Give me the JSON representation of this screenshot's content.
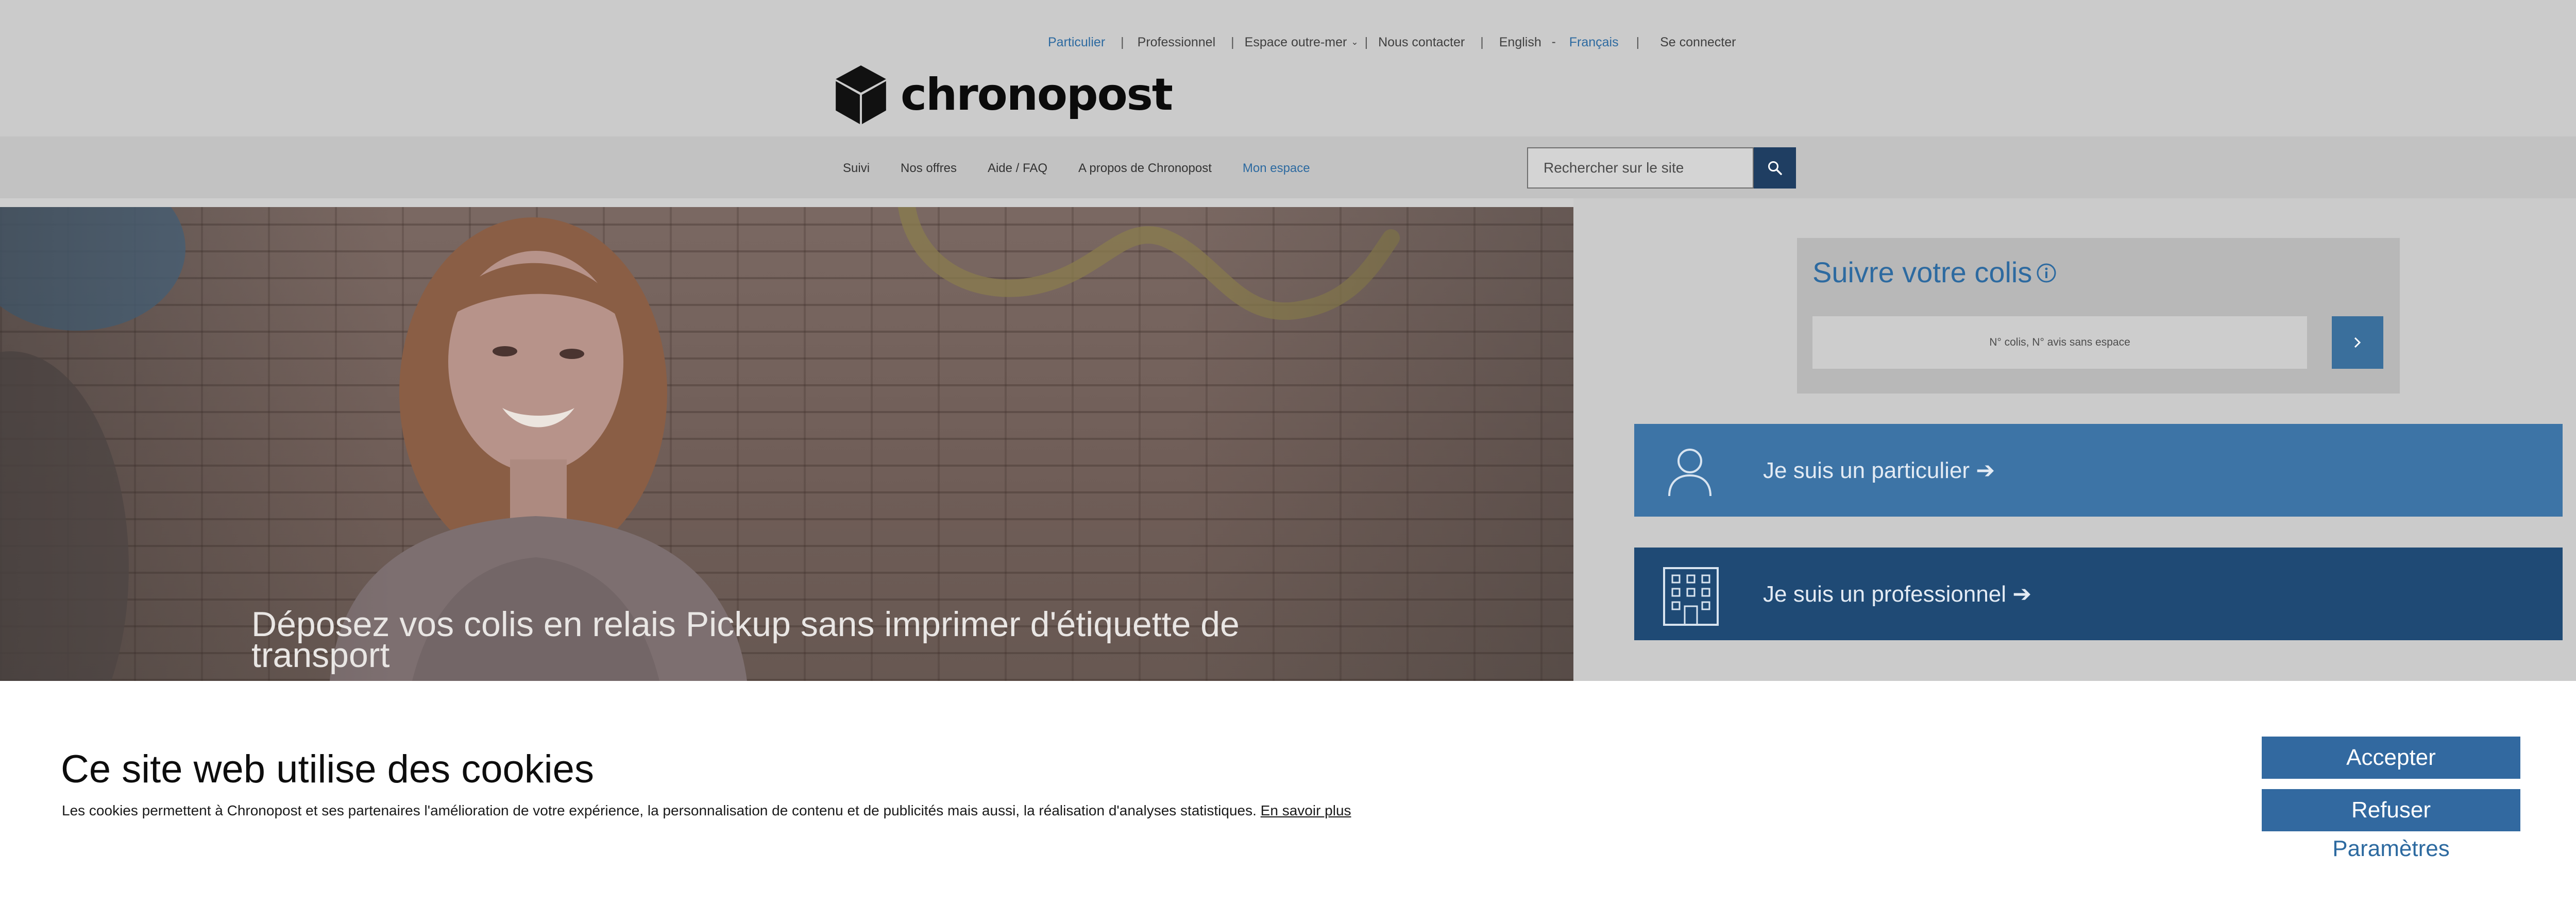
{
  "top_links": {
    "particulier": "Particulier",
    "professionnel": "Professionnel",
    "espace_outre_mer": "Espace outre-mer",
    "nous_contacter": "Nous contacter",
    "english": "English",
    "francais": "Français",
    "se_connecter": "Se connecter",
    "separator": "|"
  },
  "logo": {
    "text": "chronopost"
  },
  "nav": {
    "suivi": "Suivi",
    "nos_offres": "Nos offres",
    "aide_faq": "Aide / FAQ",
    "a_propos": "A propos de Chronopost",
    "mon_espace": "Mon espace"
  },
  "search": {
    "placeholder": "Rechercher sur le site",
    "icon": "search-icon"
  },
  "hero": {
    "title": "Déposez vos colis en relais Pickup sans imprimer d'étiquette de transport"
  },
  "tracking": {
    "title": "Suivre votre colis",
    "info_icon": "info-icon",
    "placeholder": "N° colis, N° avis sans espace",
    "submit_icon": "chevron-right-icon"
  },
  "cards": {
    "particulier": "Je suis un particulier ➔",
    "professionnel": "Je suis un professionnel ➔",
    "particulier_icon": "person-icon",
    "professionnel_icon": "building-icon"
  },
  "cookies": {
    "title": "Ce site web utilise des cookies",
    "text": "Les cookies permettent à Chronopost et ses partenaires l'amélioration de votre expérience, la personnalisation de contenu et de publicités mais aussi, la réalisation d'analyses statistiques.",
    "more": "En savoir plus",
    "accept": "Accepter",
    "refuse": "Refuser",
    "params": "Paramètres"
  },
  "colors": {
    "accent_blue": "#2d6aa0",
    "button_blue": "#3269a0",
    "card_particulier": "#3d74a6",
    "card_pro": "#1f4a75",
    "search_button": "#1f3e62"
  }
}
